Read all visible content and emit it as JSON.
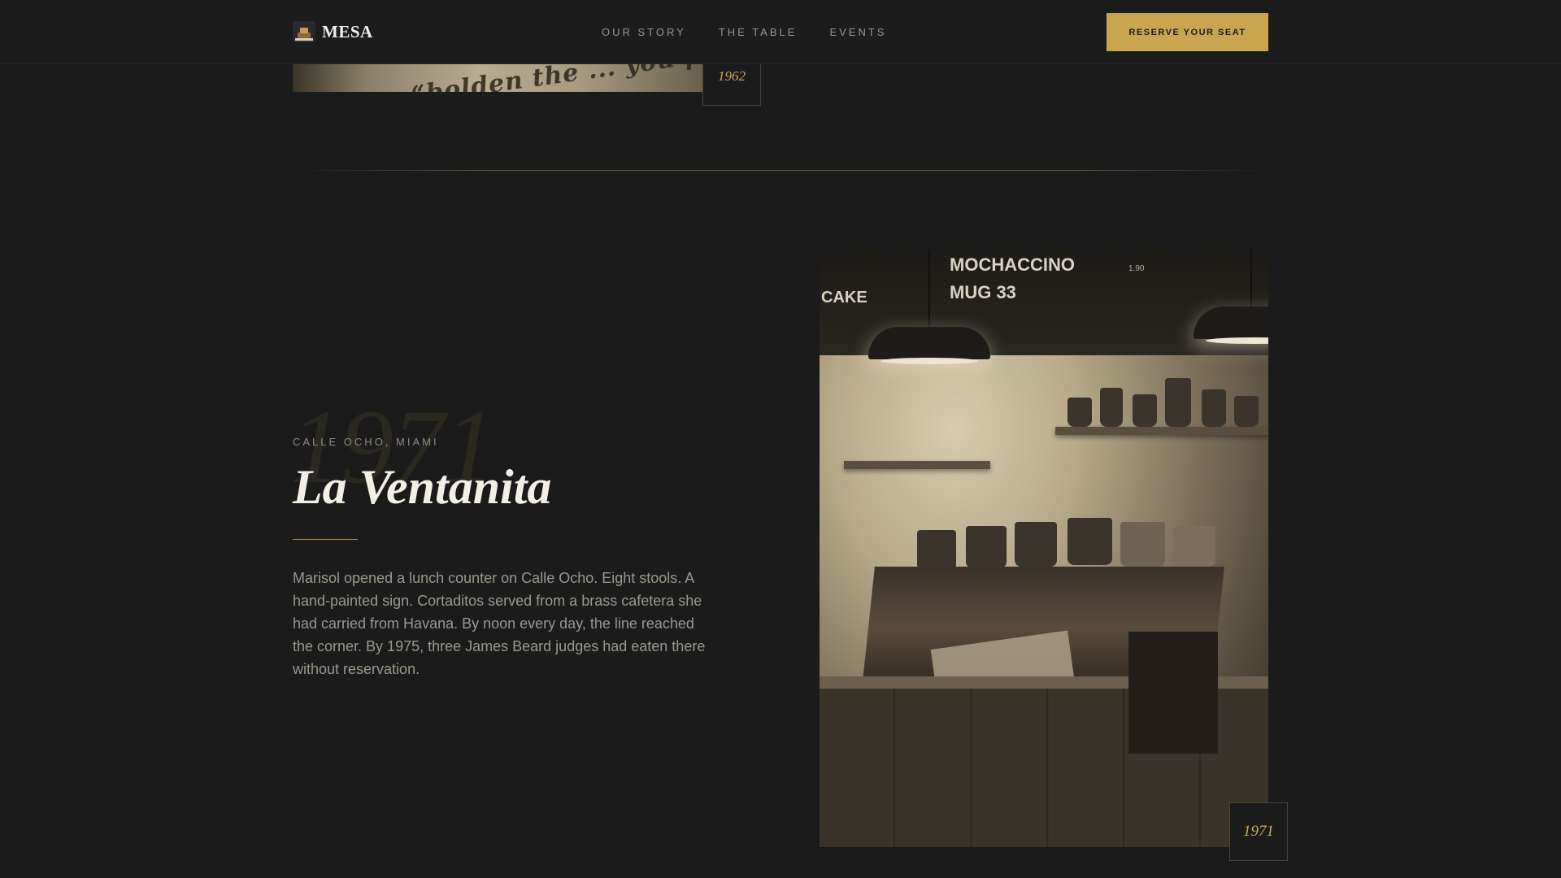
{
  "nav": {
    "brand": "MESA",
    "links": [
      "OUR STORY",
      "THE TABLE",
      "EVENTS"
    ],
    "cta": "RESERVE YOUR SEAT"
  },
  "previous_section": {
    "image_text": "because “bolden the ... you pre... flour, an ad",
    "year": "1962"
  },
  "section": {
    "year_watermark": "1971",
    "location": "CALLE OCHO, MIAMI",
    "title": "La Ventanita",
    "body": "Marisol opened a lunch counter on Calle Ocho. Eight stools. A hand-painted sign. Cortaditos served from a brass cafetera she had carried from Havana. By noon every day, the line reached the corner. By 1975, three James Beard judges had eaten there without reservation.",
    "photo_year": "1971"
  },
  "photo": {
    "chalkboard": [
      "MOCHACCINO",
      "MUG 33",
      "CAKE",
      "1.90"
    ]
  },
  "colors": {
    "background": "#1b1b1b",
    "accent": "#c9a54f",
    "year_text": "#c9a85a"
  }
}
